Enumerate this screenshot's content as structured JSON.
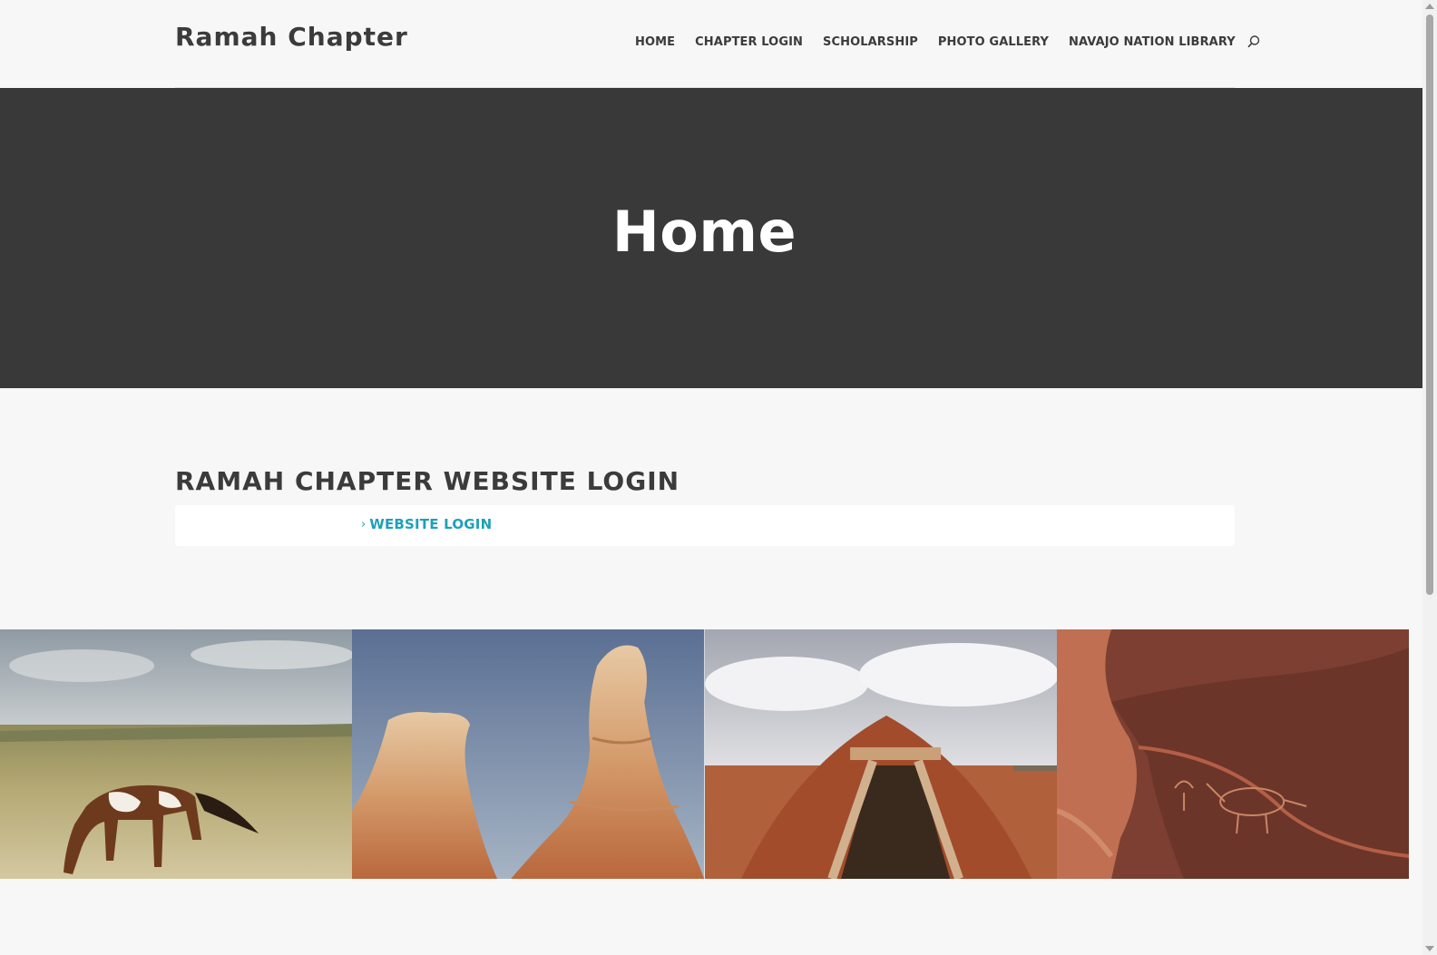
{
  "site": {
    "logo": "Ramah Chapter"
  },
  "nav": {
    "items": [
      {
        "label": "HOME"
      },
      {
        "label": "CHAPTER LOGIN"
      },
      {
        "label": "SCHOLARSHIP"
      },
      {
        "label": "PHOTO GALLERY"
      },
      {
        "label": "NAVAJO NATION LIBRARY"
      }
    ],
    "search_icon": "search-icon"
  },
  "hero": {
    "title": "Home"
  },
  "login_section": {
    "heading": "RAMAH CHAPTER WEBSITE LOGIN",
    "link_icon": "›",
    "link_label": "WEBSITE LOGIN"
  },
  "gallery": {
    "images": [
      "paint horse grazing",
      "sandstone rock formations",
      "navajo hogan",
      "petroglyph rock art"
    ]
  },
  "colors": {
    "page_bg": "#f7f7f7",
    "hero_bg": "#393939",
    "text": "#3b3b3b",
    "accent": "#1fa0b8"
  }
}
